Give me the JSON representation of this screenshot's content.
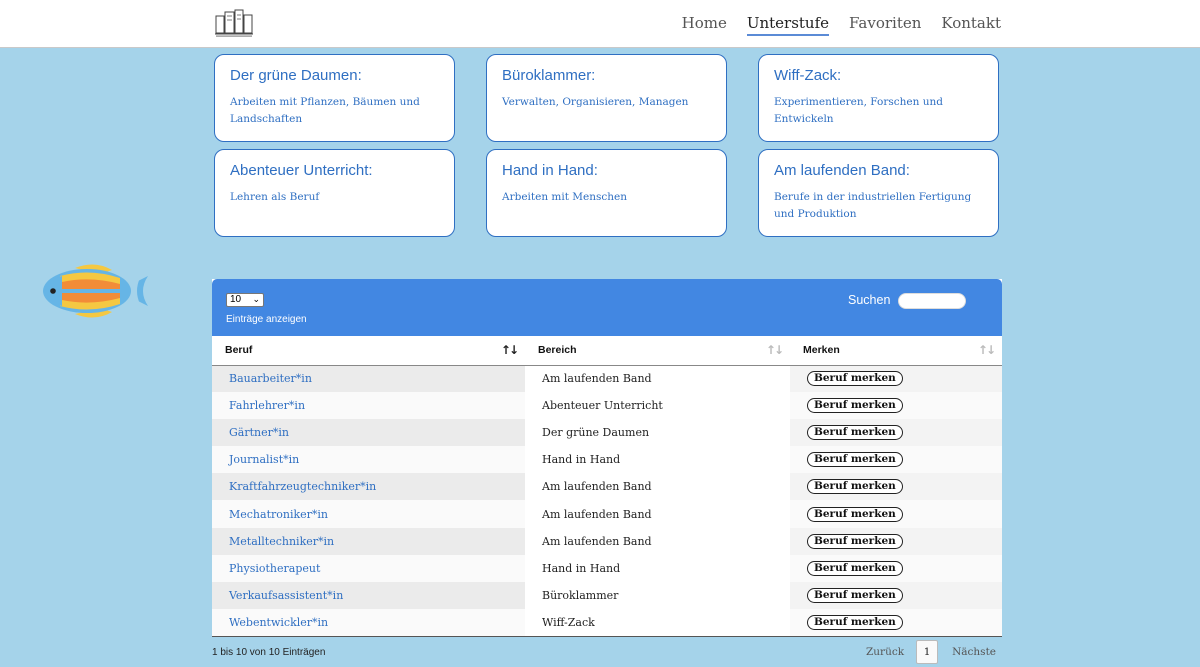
{
  "nav": {
    "items": [
      {
        "label": "Home",
        "active": false
      },
      {
        "label": "Unterstufe",
        "active": true
      },
      {
        "label": "Favoriten",
        "active": false
      },
      {
        "label": "Kontakt",
        "active": false
      }
    ]
  },
  "cards": [
    {
      "title": "Der grüne Daumen:",
      "desc": "Arbeiten mit Pflanzen, Bäumen und Landschaften"
    },
    {
      "title": "Büroklammer:",
      "desc": "Verwalten, Organisieren, Managen"
    },
    {
      "title": "Wiff-Zack:",
      "desc": "Experimentieren, Forschen und Entwickeln"
    },
    {
      "title": "Abenteuer Unterricht:",
      "desc": "Lehren als Beruf"
    },
    {
      "title": "Hand in Hand:",
      "desc": "Arbeiten mit Menschen"
    },
    {
      "title": "Am laufenden Band:",
      "desc": "Berufe in der industriellen Fertigung und Produktion"
    }
  ],
  "table_controls": {
    "length_value": "10",
    "length_label": "Einträge anzeigen",
    "search_label": "Suchen",
    "search_value": ""
  },
  "table": {
    "headers": [
      "Beruf",
      "Bereich",
      "Merken"
    ],
    "rows": [
      {
        "beruf": "Bauarbeiter*in",
        "bereich": "Am laufenden Band",
        "merken": "Beruf merken"
      },
      {
        "beruf": "Fahrlehrer*in",
        "bereich": "Abenteuer Unterricht",
        "merken": "Beruf merken"
      },
      {
        "beruf": "Gärtner*in",
        "bereich": "Der grüne Daumen",
        "merken": "Beruf merken"
      },
      {
        "beruf": "Journalist*in",
        "bereich": "Hand in Hand",
        "merken": "Beruf merken"
      },
      {
        "beruf": "Kraftfahrzeugtechniker*in",
        "bereich": "Am laufenden Band",
        "merken": "Beruf merken"
      },
      {
        "beruf": "Mechatroniker*in",
        "bereich": "Am laufenden Band",
        "merken": "Beruf merken"
      },
      {
        "beruf": "Metalltechniker*in",
        "bereich": "Am laufenden Band",
        "merken": "Beruf merken"
      },
      {
        "beruf": "Physiotherapeut",
        "bereich": "Hand in Hand",
        "merken": "Beruf merken"
      },
      {
        "beruf": "Verkaufsassistent*in",
        "bereich": "Büroklammer",
        "merken": "Beruf merken"
      },
      {
        "beruf": "Webentwickler*in",
        "bereich": "Wiff-Zack",
        "merken": "Beruf merken"
      }
    ]
  },
  "footer": {
    "info": "1 bis 10 von 10 Einträgen",
    "prev_label": "Zurück",
    "page": "1",
    "next_label": "Nächste"
  },
  "colors": {
    "background": "#a5d3ea",
    "accent": "#4287e2",
    "card_border": "#2f6fc2"
  }
}
